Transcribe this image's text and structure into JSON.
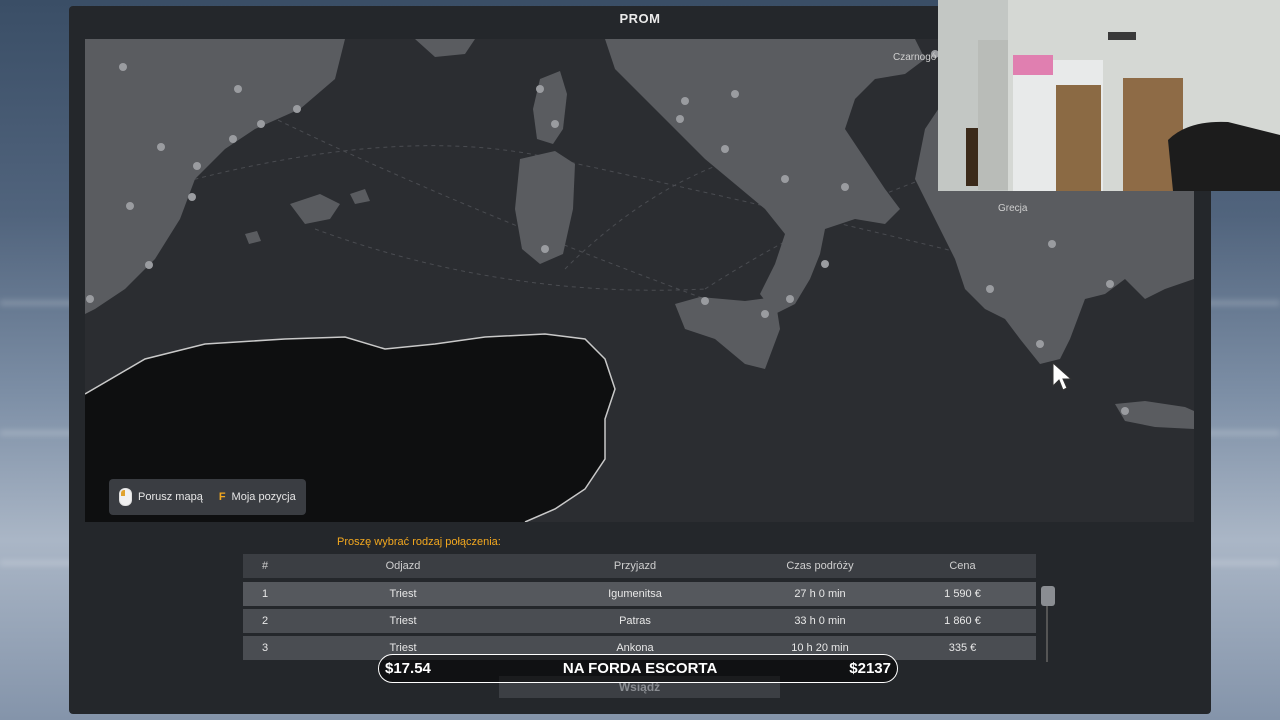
{
  "window": {
    "title": "PROM"
  },
  "map": {
    "labels": {
      "greece": "Grecja",
      "montenegro": "Czarnogó"
    },
    "hints": {
      "move_map": "Porusz mapą",
      "key_f": "F",
      "my_position": "Moja pozycja"
    }
  },
  "prompt": "Proszę wybrać rodzaj połączenia:",
  "table": {
    "headers": [
      "#",
      "Odjazd",
      "Przyjazd",
      "Czas podróży",
      "Cena"
    ],
    "rows": [
      [
        "1",
        "Triest",
        "Igumenitsa",
        "27 h 0 min",
        "1 590 €"
      ],
      [
        "2",
        "Triest",
        "Patras",
        "33 h 0 min",
        "1 860 €"
      ],
      [
        "3",
        "Triest",
        "Ankona",
        "10 h 20 min",
        "335 €"
      ]
    ]
  },
  "enter_button": "Wsiądź",
  "overlay": {
    "left": "$17.54",
    "center": "NA FORDA ESCORTA",
    "right": "$2137"
  },
  "colors": {
    "accent": "#f3a81f",
    "panel": "#24272b",
    "land": "#5a5c60"
  }
}
